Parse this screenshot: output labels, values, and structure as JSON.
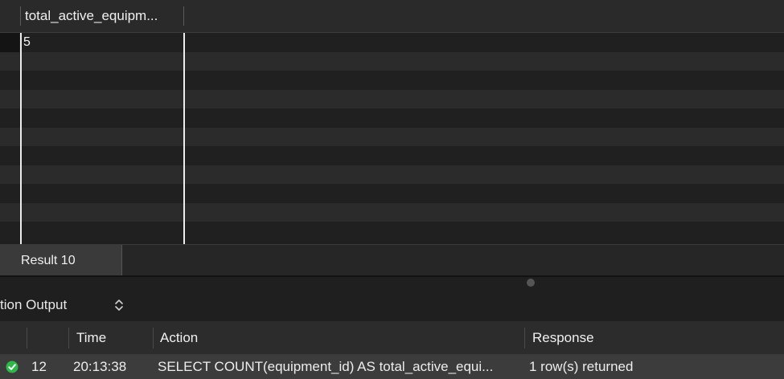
{
  "result_grid": {
    "columns": [
      "total_active_equipm..."
    ],
    "rows": [
      [
        "5"
      ]
    ],
    "empty_row_count": 10
  },
  "result_tabs": {
    "active": "Result 10"
  },
  "output_panel": {
    "title": "tion Output",
    "log_columns": {
      "time": "Time",
      "action": "Action",
      "response": "Response"
    },
    "log_rows": [
      {
        "status": "success",
        "number": "12",
        "time": "20:13:38",
        "action": "SELECT COUNT(equipment_id) AS total_active_equi...",
        "response": "1 row(s) returned"
      }
    ]
  },
  "colors": {
    "background": "#1f1f1f",
    "success": "#2fb84a"
  },
  "icons": {
    "status": "success-check-icon",
    "stepper": "updown-chevron-icon"
  }
}
